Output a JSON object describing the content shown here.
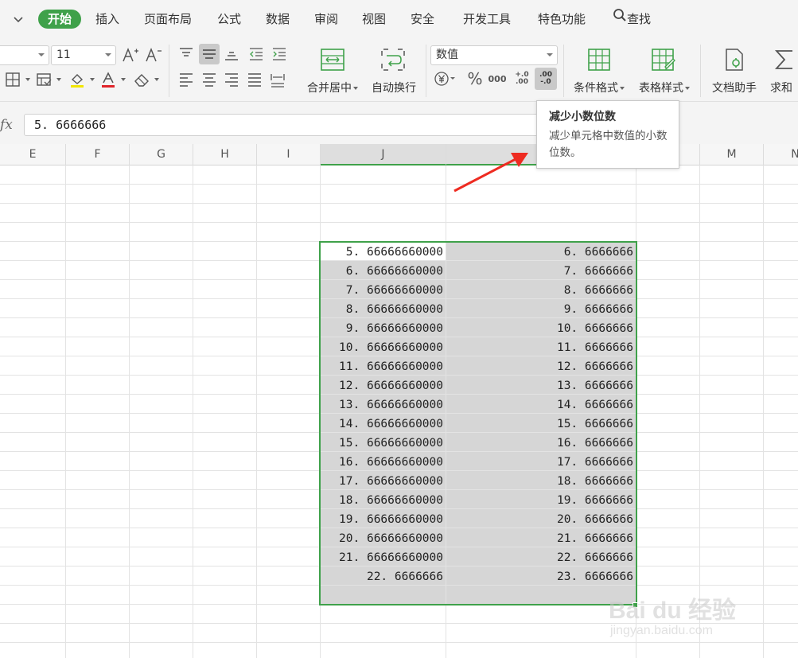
{
  "menu": {
    "items": [
      "开始",
      "插入",
      "页面布局",
      "公式",
      "数据",
      "审阅",
      "视图",
      "安全",
      "开发工具",
      "特色功能"
    ],
    "search": "查找"
  },
  "ribbon": {
    "font_size": "11",
    "merge_center": "合并居中",
    "wrap_text": "自动换行",
    "number_format": "数值",
    "conditional_format": "条件格式",
    "table_style": "表格样式",
    "doc_assistant": "文档助手",
    "sum": "求和",
    "percent_icon": "%",
    "thousands_icon": "000",
    "inc_decimal_icon": "+.0 .00",
    "dec_decimal_icon": ".00 -.0",
    "accent": "#3fa14a"
  },
  "formula_bar": {
    "fx": "fx",
    "value": "5. 6666666"
  },
  "columns": [
    "E",
    "F",
    "G",
    "H",
    "I",
    "J",
    "",
    "M",
    "N"
  ],
  "cells": {
    "J": [
      "5. 66666660000",
      "6. 66666660000",
      "7. 66666660000",
      "8. 66666660000",
      "9. 66666660000",
      "10. 66666660000",
      "11. 66666660000",
      "12. 66666660000",
      "13. 66666660000",
      "14. 66666660000",
      "15. 66666660000",
      "16. 66666660000",
      "17. 66666660000",
      "18. 66666660000",
      "19. 66666660000",
      "20. 66666660000",
      "21. 66666660000",
      "22. 6666666"
    ],
    "K": [
      "6. 6666666",
      "7. 6666666",
      "8. 6666666",
      "9. 6666666",
      "10. 6666666",
      "11. 6666666",
      "12. 6666666",
      "13. 6666666",
      "14. 6666666",
      "15. 6666666",
      "16. 6666666",
      "17. 6666666",
      "18. 6666666",
      "19. 6666666",
      "20. 6666666",
      "21. 6666666",
      "22. 6666666",
      "23. 6666666"
    ]
  },
  "tooltip": {
    "title": "减少小数位数",
    "description": "减少单元格中数值的小数位数。"
  },
  "watermark": {
    "brand": "Bai du 经验",
    "url": "jingyan.baidu.com"
  }
}
